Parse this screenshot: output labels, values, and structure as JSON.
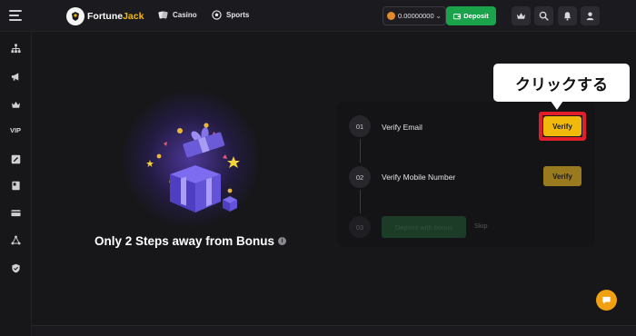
{
  "header": {
    "logo": {
      "part1": "Fortune",
      "part2": "Jack"
    },
    "nav": [
      {
        "label": "Casino",
        "icon": "cards-icon"
      },
      {
        "label": "Sports",
        "icon": "soccer-ball-icon"
      }
    ],
    "balance": {
      "amount": "0.00000000",
      "currency_icon": "coin-icon"
    },
    "deposit_label": "Deposit",
    "icons": [
      "crown-icon",
      "search-icon",
      "bell-icon",
      "user-icon"
    ]
  },
  "sidebar": {
    "items": [
      "hierarchy-icon",
      "megaphone-icon",
      "crown-icon",
      "VIP",
      "edit-icon",
      "book-icon",
      "card-icon",
      "network-icon",
      "shield-icon"
    ]
  },
  "promo": {
    "headline": "Only 2 Steps away from Bonus",
    "info_icon": "i"
  },
  "steps": [
    {
      "number": "01",
      "label": "Verify Email",
      "button": "Verify"
    },
    {
      "number": "02",
      "label": "Verify Mobile Number",
      "button": "Verify"
    },
    {
      "number": "03",
      "label": "Deposit with bonus",
      "secondary": "Skip"
    }
  ],
  "annotation": {
    "callout_text": "クリックする"
  },
  "colors": {
    "accent_yellow": "#f0b90b",
    "deposit_green": "#1aa34a",
    "highlight_red": "#e11e2a",
    "chat_orange": "#f0a010"
  }
}
